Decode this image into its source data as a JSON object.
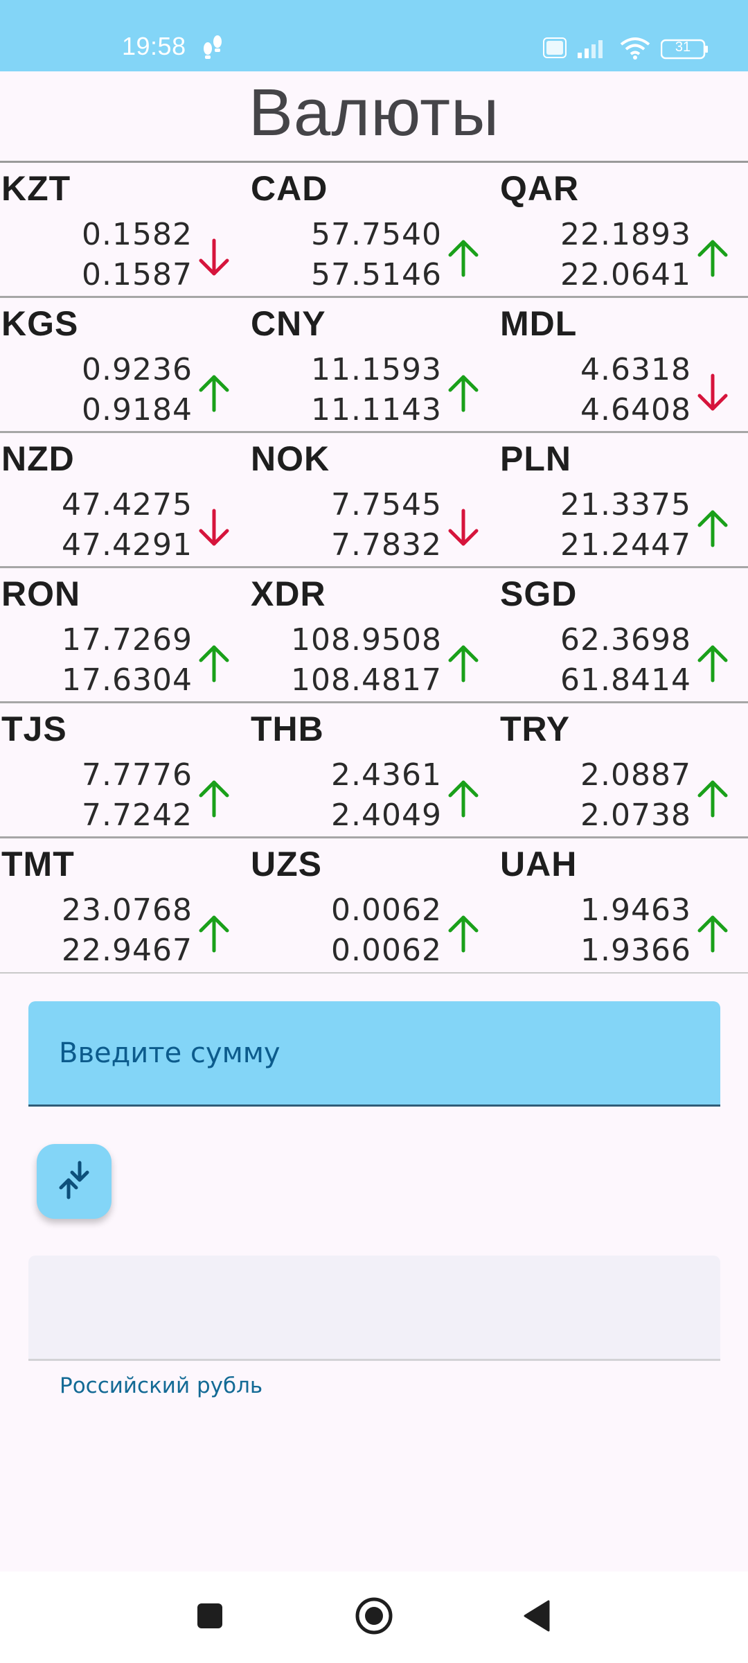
{
  "status": {
    "time": "19:58",
    "battery": "31"
  },
  "title": "Валюты",
  "currencies": [
    [
      {
        "code": "KZT",
        "v1": "0.1582",
        "v2": "0.1587",
        "dir": "down"
      },
      {
        "code": "CAD",
        "v1": "57.7540",
        "v2": "57.5146",
        "dir": "up"
      },
      {
        "code": "QAR",
        "v1": "22.1893",
        "v2": "22.0641",
        "dir": "up"
      }
    ],
    [
      {
        "code": "KGS",
        "v1": "0.9236",
        "v2": "0.9184",
        "dir": "up"
      },
      {
        "code": "CNY",
        "v1": "11.1593",
        "v2": "11.1143",
        "dir": "up"
      },
      {
        "code": "MDL",
        "v1": "4.6318",
        "v2": "4.6408",
        "dir": "down"
      }
    ],
    [
      {
        "code": "NZD",
        "v1": "47.4275",
        "v2": "47.4291",
        "dir": "down"
      },
      {
        "code": "NOK",
        "v1": "7.7545",
        "v2": "7.7832",
        "dir": "down"
      },
      {
        "code": "PLN",
        "v1": "21.3375",
        "v2": "21.2447",
        "dir": "up"
      }
    ],
    [
      {
        "code": "RON",
        "v1": "17.7269",
        "v2": "17.6304",
        "dir": "up"
      },
      {
        "code": "XDR",
        "v1": "108.9508",
        "v2": "108.4817",
        "dir": "up"
      },
      {
        "code": "SGD",
        "v1": "62.3698",
        "v2": "61.8414",
        "dir": "up"
      }
    ],
    [
      {
        "code": "TJS",
        "v1": "7.7776",
        "v2": "7.7242",
        "dir": "up"
      },
      {
        "code": "THB",
        "v1": "2.4361",
        "v2": "2.4049",
        "dir": "up"
      },
      {
        "code": "TRY",
        "v1": "2.0887",
        "v2": "2.0738",
        "dir": "up"
      }
    ],
    [
      {
        "code": "TMT",
        "v1": "23.0768",
        "v2": "22.9467",
        "dir": "up"
      },
      {
        "code": "UZS",
        "v1": "0.0062",
        "v2": "0.0062",
        "dir": "up"
      },
      {
        "code": "UAH",
        "v1": "1.9463",
        "v2": "1.9366",
        "dir": "up"
      }
    ]
  ],
  "colors": {
    "up": "#1aa01a",
    "down": "#d6143c",
    "accent": "#83d5f7"
  },
  "amount_input": {
    "placeholder": "Введите сумму",
    "value": ""
  },
  "convert_button": {
    "icon": "swap-vertical-icon"
  },
  "result": {
    "value": "",
    "caption": "Российский рубль"
  },
  "nav": {
    "recents": "square-icon",
    "home": "circle-icon",
    "back": "triangle-back-icon"
  }
}
